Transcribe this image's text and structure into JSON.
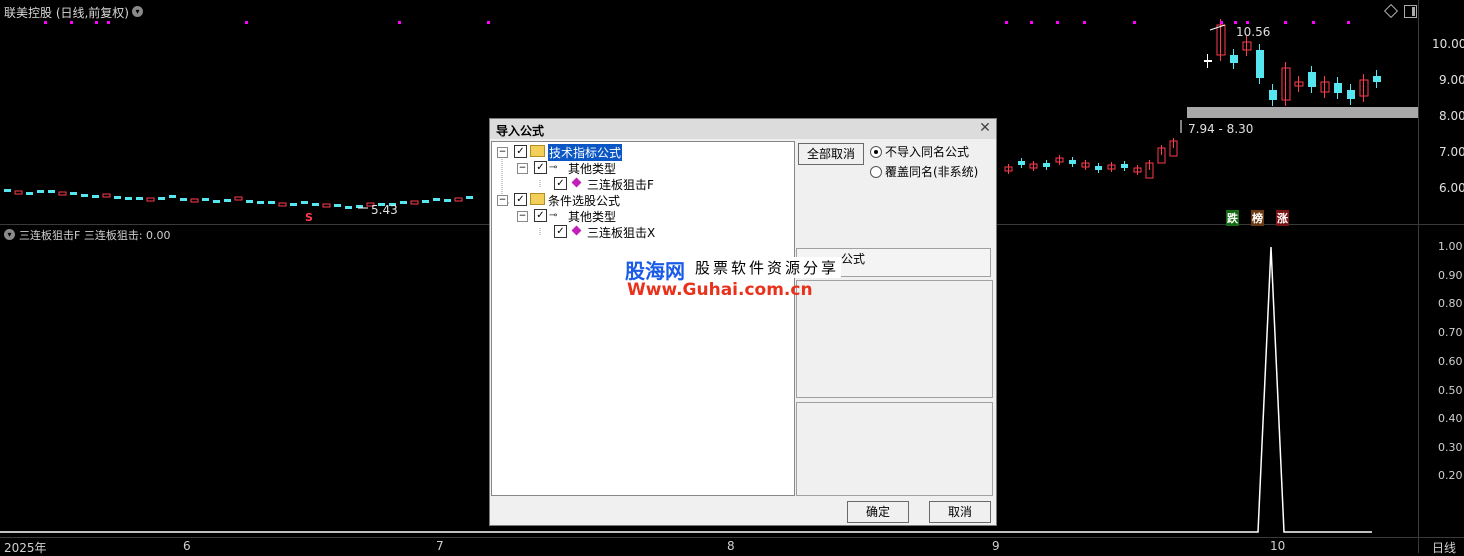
{
  "header": {
    "title": "联美控股 (日线,前复权)"
  },
  "price_axis": {
    "labels": [
      "10.00",
      "9.00",
      "8.00",
      "7.00",
      "6.00"
    ]
  },
  "chart_annotations": {
    "high_label": "10.56",
    "low_label": "5.43",
    "range_label": "7.94 - 8.30",
    "signal_s": "S",
    "tag_fall": "跌",
    "tag_list": "榜",
    "tag_rise": "涨"
  },
  "indicator": {
    "header": "三连板狙击F  三连板狙击: 0.00",
    "axis_labels": [
      "1.00",
      "0.90",
      "0.80",
      "0.70",
      "0.60",
      "0.50",
      "0.40",
      "0.30",
      "0.20"
    ]
  },
  "date_axis": {
    "labels": [
      "2025年",
      "6",
      "7",
      "8",
      "9",
      "10"
    ],
    "period": "日线"
  },
  "dialog": {
    "title": "导入公式",
    "tree": [
      {
        "label": "技术指标公式"
      },
      {
        "label": "其他类型"
      },
      {
        "label": "三连板狙击F"
      },
      {
        "label": "条件选股公式"
      },
      {
        "label": "其他类型"
      },
      {
        "label": "三连板狙击X"
      }
    ],
    "btn_uncheck_all": "全部取消",
    "radio_skip": "不导入同名公式",
    "radio_overwrite": "覆盖同名(非系统)",
    "formula_label": "公式",
    "btn_ok": "确定",
    "btn_cancel": "取消"
  },
  "watermark": {
    "brand": "股海网",
    "slogan": "股票软件资源分享",
    "url": "Www.Guhai.com.cn"
  },
  "colors": {
    "up": "#ff3b4e",
    "down": "#55e6f0",
    "marker": "#ff00ff",
    "indicator_line": "#ffffff"
  }
}
